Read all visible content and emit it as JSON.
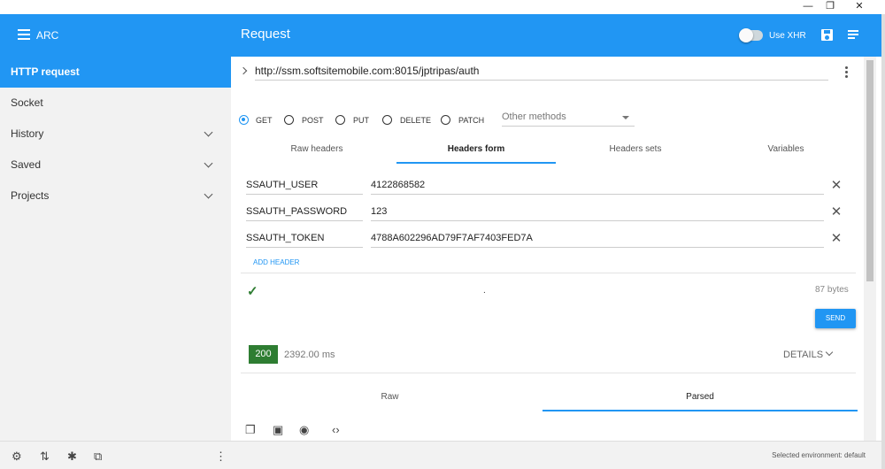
{
  "window": {
    "minimize": "—",
    "maximize": "❐",
    "close": "✕"
  },
  "appbar": {
    "app_name": "ARC",
    "title": "Request",
    "xhr_label": "Use XHR"
  },
  "sidebar": {
    "items": [
      {
        "label": "HTTP request"
      },
      {
        "label": "Socket"
      },
      {
        "label": "History"
      },
      {
        "label": "Saved"
      },
      {
        "label": "Projects"
      }
    ]
  },
  "request": {
    "url": "http://ssm.softsitemobile.com:8015/jptripas/auth",
    "methods": [
      "GET",
      "POST",
      "PUT",
      "DELETE",
      "PATCH"
    ],
    "selected_method": "GET",
    "other_methods_placeholder": "Other methods"
  },
  "tabs": [
    "Raw headers",
    "Headers form",
    "Headers sets",
    "Variables"
  ],
  "headers": [
    {
      "name": "SSAUTH_USER",
      "value": "4122868582"
    },
    {
      "name": "SSAUTH_PASSWORD",
      "value": "123"
    },
    {
      "name": "SSAUTH_TOKEN",
      "value": "4788A602296AD79F7AF7403FED7A"
    }
  ],
  "add_header_label": "ADD HEADER",
  "body": {
    "dot": ".",
    "size": "87 bytes"
  },
  "send_label": "SEND",
  "response": {
    "status": "200",
    "time": "2392.00 ms",
    "details_label": "DETAILS"
  },
  "response_tabs": [
    "Raw",
    "Parsed"
  ],
  "footer": {
    "environment": "Selected environment: default"
  },
  "colors": {
    "accent": "#2196f3",
    "success": "#2e7d32"
  }
}
